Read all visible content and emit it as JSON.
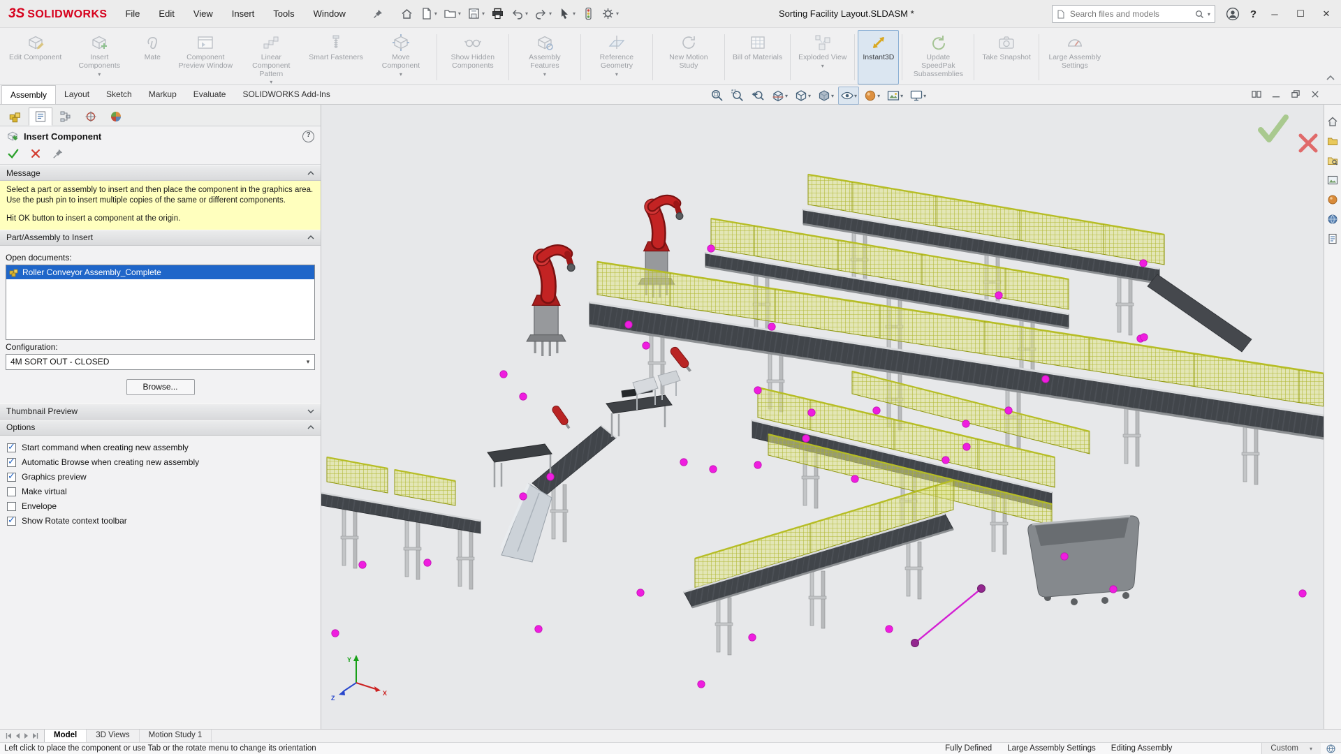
{
  "titlebar": {
    "logo": "3S",
    "brand": "SOLIDWORKS",
    "menus": [
      "File",
      "Edit",
      "View",
      "Insert",
      "Tools",
      "Window"
    ],
    "document_title": "Sorting Facility Layout.SLDASM *",
    "search_placeholder": "Search files and models"
  },
  "ribbon": {
    "buttons": [
      {
        "label": "Edit Component",
        "enabled": false,
        "dropdown": false
      },
      {
        "label": "Insert Components",
        "enabled": false,
        "dropdown": true
      },
      {
        "label": "Mate",
        "enabled": false,
        "dropdown": false
      },
      {
        "label": "Component Preview Window",
        "enabled": false,
        "dropdown": false
      },
      {
        "label": "Linear Component Pattern",
        "enabled": false,
        "dropdown": true
      },
      {
        "label": "Smart Fasteners",
        "enabled": false,
        "dropdown": false
      },
      {
        "label": "Move Component",
        "enabled": false,
        "dropdown": true
      },
      {
        "label": "Show Hidden Components",
        "enabled": false,
        "dropdown": false
      },
      {
        "label": "Assembly Features",
        "enabled": false,
        "dropdown": true
      },
      {
        "label": "Reference Geometry",
        "enabled": false,
        "dropdown": true
      },
      {
        "label": "New Motion Study",
        "enabled": false,
        "dropdown": false
      },
      {
        "label": "Bill of Materials",
        "enabled": false,
        "dropdown": false
      },
      {
        "label": "Exploded View",
        "enabled": false,
        "dropdown": true
      },
      {
        "label": "Instant3D",
        "enabled": true,
        "dropdown": false,
        "active": true
      },
      {
        "label": "Update SpeedPak Subassemblies",
        "enabled": false,
        "dropdown": false
      },
      {
        "label": "Take Snapshot",
        "enabled": false,
        "dropdown": false
      },
      {
        "label": "Large Assembly Settings",
        "enabled": false,
        "dropdown": false
      }
    ]
  },
  "command_tabs": {
    "items": [
      "Assembly",
      "Layout",
      "Sketch",
      "Markup",
      "Evaluate",
      "SOLIDWORKS Add-Ins"
    ],
    "active": "Assembly"
  },
  "property_manager": {
    "title": "Insert Component",
    "sections": {
      "message": {
        "header": "Message",
        "body1": "Select a part or assembly to insert and then place the component in the graphics area. Use the push pin to insert multiple copies of the same or different components.",
        "body2": "Hit OK button to insert a component at the origin."
      },
      "part_assembly": {
        "header": "Part/Assembly to Insert",
        "open_documents_label": "Open documents:",
        "documents": [
          {
            "name": "Roller Conveyor Assembly_Complete",
            "selected": true
          }
        ],
        "configuration_label": "Configuration:",
        "configuration_value": "4M SORT OUT - CLOSED",
        "browse_label": "Browse..."
      },
      "thumbnail": {
        "header": "Thumbnail Preview"
      },
      "options": {
        "header": "Options",
        "items": [
          {
            "label": "Start command when creating new assembly",
            "checked": true
          },
          {
            "label": "Automatic Browse when creating new assembly",
            "checked": true
          },
          {
            "label": "Graphics preview",
            "checked": true
          },
          {
            "label": "Make virtual",
            "checked": false
          },
          {
            "label": "Envelope",
            "checked": false
          },
          {
            "label": "Show Rotate context toolbar",
            "checked": true
          }
        ]
      }
    }
  },
  "viewport": {
    "triad": {
      "x": "X",
      "y": "Y",
      "z": "Z"
    }
  },
  "bottom_bar": {
    "tabs": [
      "Model",
      "3D Views",
      "Motion Study 1"
    ],
    "active": "Model"
  },
  "status_bar": {
    "hint": "Left click to place the component or use Tab or the rotate menu to change its orientation",
    "items": [
      "Fully Defined",
      "Large Assembly Settings",
      "Editing Assembly"
    ],
    "display_mode": "Custom"
  }
}
